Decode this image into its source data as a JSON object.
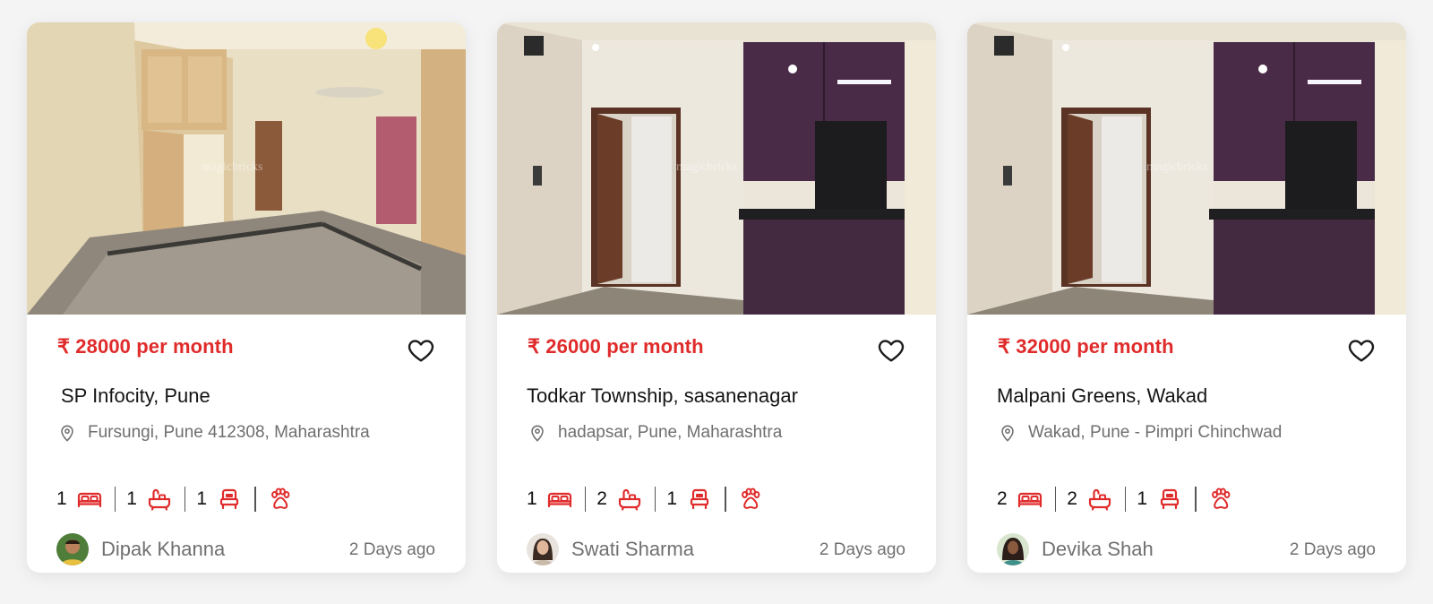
{
  "listings": [
    {
      "price": "₹ 28000 per month",
      "title": "SP Infocity, Pune",
      "location": "Fursungi, Pune 412308, Maharashtra",
      "bedrooms": "1",
      "bathrooms": "1",
      "beds": "1",
      "owner": "Dipak Khanna",
      "posted": "2 Days ago",
      "photo_watermark": "magicbricks"
    },
    {
      "price": "₹ 26000 per month",
      "title": "Todkar Township, sasanenagar",
      "location": "hadapsar, Pune, Maharashtra",
      "bedrooms": "1",
      "bathrooms": "2",
      "beds": "1",
      "owner": "Swati Sharma",
      "posted": "2 Days ago",
      "photo_watermark": "magicbricks"
    },
    {
      "price": "₹ 32000 per month",
      "title": "Malpani Greens, Wakad",
      "location": "Wakad, Pune - Pimpri Chinchwad",
      "bedrooms": "2",
      "bathrooms": "2",
      "beds": "1",
      "owner": "Devika Shah",
      "posted": "2 Days ago",
      "photo_watermark": "magicbricks"
    }
  ],
  "icons": {
    "favorite": "heart-outline-icon",
    "location": "map-pin-icon",
    "bedrooms": "bed-icon",
    "bathrooms": "bathtub-icon",
    "beds": "single-bed-icon",
    "pets": "paw-icon"
  },
  "colors": {
    "accent": "#e02b2b",
    "card_background": "#ffffff",
    "page_background": "#f4f4f5",
    "muted_text": "#707070"
  }
}
